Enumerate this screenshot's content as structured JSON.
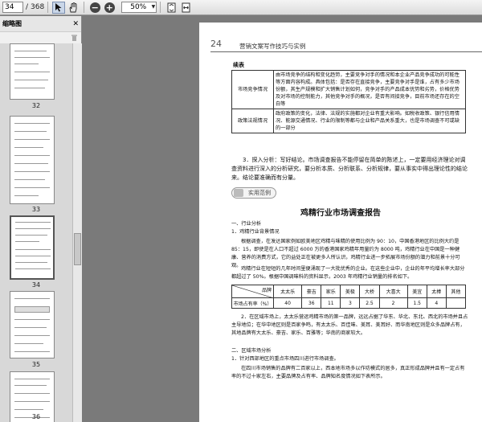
{
  "toolbar": {
    "page_current": "34",
    "page_sep": "/",
    "page_total": "368",
    "zoom_value": "50%"
  },
  "sidebar": {
    "title": "缩略图",
    "thumb_labels": [
      "32",
      "33",
      "34",
      "35",
      "36"
    ]
  },
  "page": {
    "number": "24",
    "header": "营销文案写作技巧与实例",
    "continued": "续表",
    "table1": [
      {
        "key": "市场竞争情况",
        "value": "由市场竞争的结构和变化趋势，主要竞争对手的情况和本企业产品竞争成功的可能性等方面内容构成。具体包括：是否存在直接竞争，主要竞争对手是谁，占有多少市场份额，其生产规模和扩大销售计划如何，竞争对手的产品成本优势和劣势，价格优势及对市场的控制能力，其他竞争对手的概况，是否有间接竞争，目前市场还存在的空白等"
      },
      {
        "key": "政策法规情况",
        "value": "政府政策的变化，法律、法规的实施都对企业有重大影响。如税收政策、银行信用情况、能源交通情况、行业的限制等都与企业和产品关系重大，也是市场调查不可或缺的一部分"
      }
    ],
    "para3": "3．探入分析：写好结论。市场调查报告不能停留在简单的陈述上，一定要用经济理论对调查资料进行深入的分析研究，要分析本质、分析联系、分析规律，要从事实中得出理论性的结论来。结论要准确而有分量。",
    "badge": "实用范例",
    "report_title": "鸡精行业市场调查报告",
    "s1": "一、行业分析",
    "s1_1": "1．鸡精行业背景情况",
    "s1_text": "根据调查，在发达国家例如欧美地区鸡精与味精的使用比例为 90：10，中国香港地区的比例大约是 85：15，即使是在人口不超过 6000 万的香港国家鸡精年用量约为 8000 吨，鸡精行业在中国是一种健康、营养的消费方式，它的益处正在被更多人所认识，鸡精行业进一步拓展市场份额的潜力和前景十分可观。",
    "s1_text2": "鸡精行业在短短的几年时间里便涌现了一大批优秀的企业。在这些企业中，企业的年平均增长率大部分都超过了 50%。根据中国调味料的资料显示，2003 年鸡精行业销量的排名如下。",
    "table2": {
      "brand_label": "品牌",
      "share_label": "市场占有率（%）",
      "brands": [
        "太太乐",
        "豪吉",
        "家乐",
        "美极",
        "大桥",
        "大喜大",
        "美宜",
        "太棒",
        "其他"
      ],
      "shares": [
        "40",
        "36",
        "11",
        "3",
        "2.5",
        "2",
        "1.5",
        "4",
        ""
      ]
    },
    "s2_text": "2．在区域市场上，太太乐营运鸡精市场的第一品牌，远远占据了华东、华北、东北、西北的市场并且占主导地位；在华中地区则是百家争鸣，有太太乐、百佳味、美耳、美耳好、而华南地区则是众多品牌占有，其地品牌有大太乐、豪吉、家乐、百雅等；华南的商家较大。",
    "s2": "二、区域市场分析",
    "s2_1": "1．针对西部地区的重点市场四川进行市场调查。",
    "s2_1_text": "在四川市场销售的品牌有二百家以上，西本地市场多以作坊模式的居多，真正形成品牌并且有一定占有率的不过十家左右，主要品牌及占有率、品牌知名度情况如下表所示。"
  }
}
